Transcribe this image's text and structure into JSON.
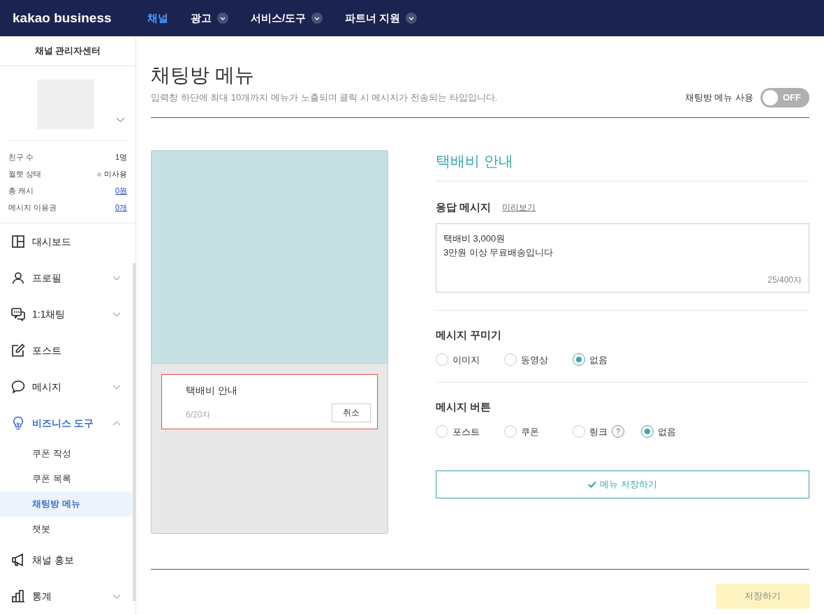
{
  "header": {
    "logo": "kakao business",
    "nav": [
      {
        "label": "채널",
        "selected": true,
        "dropdown": false
      },
      {
        "label": "광고",
        "selected": false,
        "dropdown": true
      },
      {
        "label": "서비스/도구",
        "selected": false,
        "dropdown": true
      },
      {
        "label": "파트너 지원",
        "selected": false,
        "dropdown": true
      }
    ]
  },
  "sidebar": {
    "title": "채널 관리자센터",
    "stats": [
      {
        "label": "친구 수",
        "value": "1명",
        "kind": "plain"
      },
      {
        "label": "월렛 상태",
        "value": "미사용",
        "kind": "status",
        "color": "#cccccc"
      },
      {
        "label": "총 캐시",
        "value": "0원",
        "kind": "link"
      },
      {
        "label": "메시지 이용권",
        "value": "0개",
        "kind": "link"
      }
    ],
    "items": [
      {
        "label": "대시보드",
        "expandable": false,
        "selected": false
      },
      {
        "label": "프로필",
        "expandable": true,
        "expanded": false,
        "selected": false
      },
      {
        "label": "1:1채팅",
        "expandable": true,
        "expanded": false,
        "selected": false
      },
      {
        "label": "포스트",
        "expandable": false,
        "selected": false
      },
      {
        "label": "메시지",
        "expandable": true,
        "expanded": false,
        "selected": false
      },
      {
        "label": "비즈니스 도구",
        "expandable": true,
        "expanded": true,
        "selected": true,
        "children": [
          {
            "label": "쿠폰 작성",
            "selected": false
          },
          {
            "label": "쿠폰 목록",
            "selected": false
          },
          {
            "label": "채팅방 메뉴",
            "selected": true
          },
          {
            "label": "챗봇",
            "selected": false
          }
        ]
      },
      {
        "label": "채널 홍보",
        "expandable": false,
        "selected": false
      },
      {
        "label": "통계",
        "expandable": true,
        "expanded": false,
        "selected": false
      }
    ]
  },
  "page": {
    "title": "채팅방 메뉴",
    "description": "입력창 하단에 최대 10개까지 메뉴가 노출되며 클릭 시 메시지가 전송되는 타입입니다.",
    "toggle": {
      "label": "채팅방 메뉴 사용",
      "on": false,
      "text": "OFF"
    }
  },
  "preview": {
    "menu_name": "택배비 안내",
    "counter": "6/20자",
    "cancel": "취소"
  },
  "form": {
    "heading": "택배비 안내",
    "response": {
      "label": "응답 메시지",
      "link": "미리보기",
      "value": "택배비 3,000원\n3만원 이상 무료배송입니다",
      "counter": "25/400자"
    },
    "groups": [
      {
        "label": "메시지 꾸미기",
        "options": [
          {
            "label": "이미지",
            "selected": false,
            "help": false
          },
          {
            "label": "동영상",
            "selected": false,
            "help": false
          },
          {
            "label": "없음",
            "selected": true,
            "help": false
          }
        ]
      },
      {
        "label": "메시지 버튼",
        "options": [
          {
            "label": "포스트",
            "selected": false,
            "help": false
          },
          {
            "label": "쿠폰",
            "selected": false,
            "help": false
          },
          {
            "label": "링크",
            "selected": false,
            "help": true,
            "help_text": "?"
          },
          {
            "label": "없음",
            "selected": true,
            "help": false
          }
        ]
      }
    ],
    "save_menu": "메뉴 저장하기"
  },
  "footer": {
    "save": "저장하기",
    "disabled": true
  }
}
